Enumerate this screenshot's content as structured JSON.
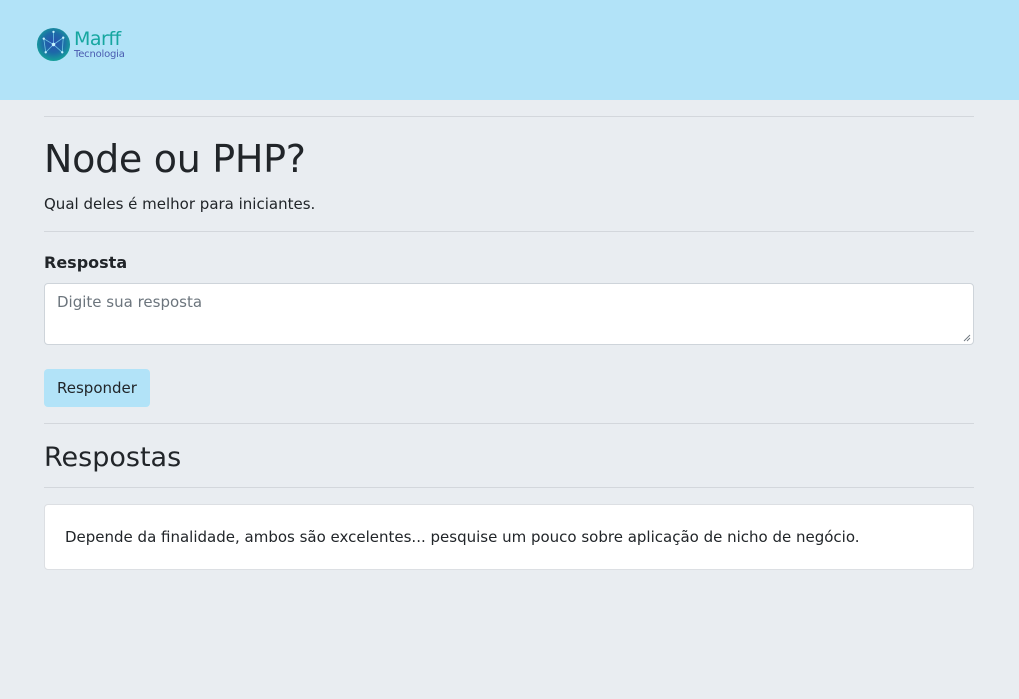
{
  "header": {
    "logo": {
      "name": "Marff",
      "subtitle": "Tecnologia",
      "icon": "globe-network-icon"
    },
    "background_color": "#b2e3f8"
  },
  "question": {
    "title": "Node ou PHP?",
    "description": "Qual deles é melhor para iniciantes."
  },
  "answer_form": {
    "label": "Resposta",
    "placeholder": "Digite sua resposta",
    "value": "",
    "submit_label": "Responder",
    "submit_color": "#b2e3f8"
  },
  "answers": {
    "section_title": "Respostas",
    "items": [
      {
        "text": "Depende da finalidade, ambos são excelentes... pesquise um pouco sobre aplicação de nicho de negócio."
      }
    ]
  }
}
